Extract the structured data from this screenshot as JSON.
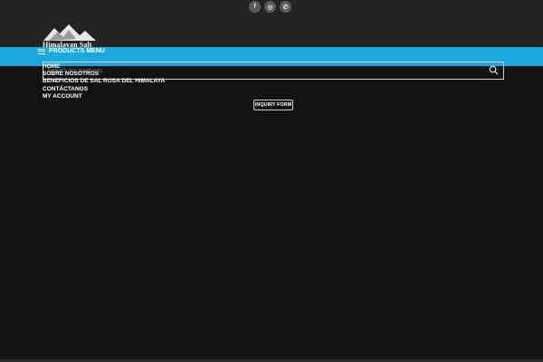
{
  "social": {
    "facebook": "f",
    "instagram": "◎",
    "whatsapp": "✆"
  },
  "logo": {
    "text": "Himalayan Salt"
  },
  "menu": {
    "products_label": "PRODUCTS MENU"
  },
  "search": {
    "placeholder": "Search for products"
  },
  "nav": {
    "items": [
      "HOME",
      "SOBRE NOSOTROS",
      "BENEFICIOS DE SAL ROSA DEL HIMALAYA",
      "CONTÁCTANOS",
      "MY ACCOUNT"
    ]
  },
  "inquiry": {
    "label": "INQUIRY FORM"
  },
  "colors": {
    "background": "#121212",
    "topbar": "#242424",
    "accent_blue": "#1aa8dd"
  }
}
